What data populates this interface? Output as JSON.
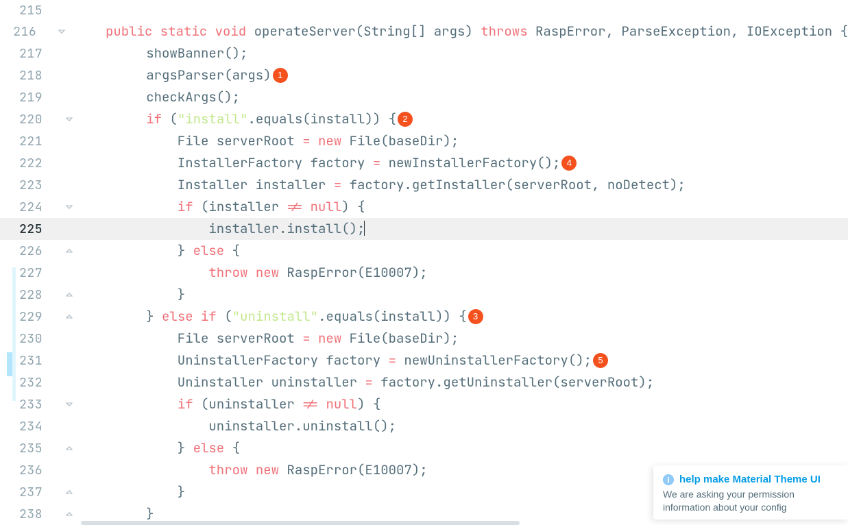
{
  "lines": [
    {
      "num": 215,
      "fold": "",
      "hl": false,
      "badge": null,
      "tokens": []
    },
    {
      "num": 216,
      "fold": "start",
      "hl": false,
      "badge": null,
      "tokens": [
        [
          "pun",
          "    "
        ],
        [
          "kw",
          "public"
        ],
        [
          "pun",
          " "
        ],
        [
          "kw",
          "static"
        ],
        [
          "pun",
          " "
        ],
        [
          "kw",
          "void"
        ],
        [
          "pun",
          " "
        ],
        [
          "id",
          "operateServer(String[] args) "
        ],
        [
          "kw",
          "throws"
        ],
        [
          "pun",
          " RaspError, ParseException, IOException {"
        ]
      ]
    },
    {
      "num": 217,
      "fold": "",
      "hl": false,
      "badge": null,
      "tokens": [
        [
          "pun",
          "        showBanner();"
        ]
      ]
    },
    {
      "num": 218,
      "fold": "",
      "hl": false,
      "badge": "1",
      "tokens": [
        [
          "pun",
          "        argsParser(args)"
        ]
      ]
    },
    {
      "num": 219,
      "fold": "",
      "hl": false,
      "badge": null,
      "tokens": [
        [
          "pun",
          "        checkArgs();"
        ]
      ]
    },
    {
      "num": 220,
      "fold": "start",
      "hl": false,
      "badge": "2",
      "tokens": [
        [
          "pun",
          "        "
        ],
        [
          "kw",
          "if"
        ],
        [
          "pun",
          " ("
        ],
        [
          "str",
          "\"install\""
        ],
        [
          "pun",
          ".equals(install)) {"
        ]
      ]
    },
    {
      "num": 221,
      "fold": "",
      "hl": false,
      "badge": null,
      "tokens": [
        [
          "pun",
          "            File serverRoot "
        ],
        [
          "op",
          "="
        ],
        [
          "pun",
          " "
        ],
        [
          "kw",
          "new"
        ],
        [
          "pun",
          " File(baseDir);"
        ]
      ]
    },
    {
      "num": 222,
      "fold": "",
      "hl": false,
      "badge": "4",
      "tokens": [
        [
          "pun",
          "            InstallerFactory factory "
        ],
        [
          "op",
          "="
        ],
        [
          "pun",
          " newInstallerFactory();"
        ]
      ]
    },
    {
      "num": 223,
      "fold": "",
      "hl": false,
      "badge": null,
      "tokens": [
        [
          "pun",
          "            Installer installer "
        ],
        [
          "op",
          "="
        ],
        [
          "pun",
          " factory.getInstaller(serverRoot, noDetect);"
        ]
      ]
    },
    {
      "num": 224,
      "fold": "start",
      "hl": false,
      "badge": null,
      "tokens": [
        [
          "pun",
          "            "
        ],
        [
          "kw",
          "if"
        ],
        [
          "pun",
          " (installer "
        ],
        [
          "op",
          "!="
        ],
        [
          "pun",
          " "
        ],
        [
          "kw",
          "null"
        ],
        [
          "pun",
          ") {"
        ]
      ]
    },
    {
      "num": 225,
      "fold": "",
      "hl": true,
      "badge": null,
      "cursor": true,
      "tokens": [
        [
          "pun",
          "                installer.install();"
        ]
      ]
    },
    {
      "num": 226,
      "fold": "end",
      "hl": false,
      "badge": null,
      "tokens": [
        [
          "pun",
          "            } "
        ],
        [
          "kw",
          "else"
        ],
        [
          "pun",
          " {"
        ]
      ]
    },
    {
      "num": 227,
      "fold": "",
      "hl": false,
      "mark": true,
      "badge": null,
      "tokens": [
        [
          "pun",
          "                "
        ],
        [
          "kw",
          "throw"
        ],
        [
          "pun",
          " "
        ],
        [
          "kw",
          "new"
        ],
        [
          "pun",
          " RaspError(E10007);"
        ]
      ]
    },
    {
      "num": 228,
      "fold": "end",
      "hl": false,
      "mark": true,
      "badge": null,
      "tokens": [
        [
          "pun",
          "            }"
        ]
      ]
    },
    {
      "num": 229,
      "fold": "end",
      "hl": false,
      "mark": true,
      "badge": "3",
      "tokens": [
        [
          "pun",
          "        } "
        ],
        [
          "kw",
          "else"
        ],
        [
          "pun",
          " "
        ],
        [
          "kw",
          "if"
        ],
        [
          "pun",
          " ("
        ],
        [
          "str",
          "\"uninstall\""
        ],
        [
          "pun",
          ".equals(install)) {"
        ]
      ]
    },
    {
      "num": 230,
      "fold": "",
      "hl": false,
      "mark": true,
      "badge": null,
      "tokens": [
        [
          "pun",
          "            File serverRoot "
        ],
        [
          "op",
          "="
        ],
        [
          "pun",
          " "
        ],
        [
          "kw",
          "new"
        ],
        [
          "pun",
          " File(baseDir);"
        ]
      ]
    },
    {
      "num": 231,
      "fold": "",
      "hl": false,
      "mark": true,
      "markStrong": true,
      "badge": "5",
      "tokens": [
        [
          "pun",
          "            UninstallerFactory factory "
        ],
        [
          "op",
          "="
        ],
        [
          "pun",
          " newUninstallerFactory();"
        ]
      ]
    },
    {
      "num": 232,
      "fold": "",
      "hl": false,
      "mark": true,
      "badge": null,
      "tokens": [
        [
          "pun",
          "            Uninstaller uninstaller "
        ],
        [
          "op",
          "="
        ],
        [
          "pun",
          " factory.getUninstaller(serverRoot);"
        ]
      ]
    },
    {
      "num": 233,
      "fold": "start",
      "hl": false,
      "badge": null,
      "tokens": [
        [
          "pun",
          "            "
        ],
        [
          "kw",
          "if"
        ],
        [
          "pun",
          " (uninstaller "
        ],
        [
          "op",
          "!="
        ],
        [
          "pun",
          " "
        ],
        [
          "kw",
          "null"
        ],
        [
          "pun",
          ") {"
        ]
      ]
    },
    {
      "num": 234,
      "fold": "",
      "hl": false,
      "badge": null,
      "tokens": [
        [
          "pun",
          "                uninstaller.uninstall();"
        ]
      ]
    },
    {
      "num": 235,
      "fold": "end",
      "hl": false,
      "badge": null,
      "tokens": [
        [
          "pun",
          "            } "
        ],
        [
          "kw",
          "else"
        ],
        [
          "pun",
          " {"
        ]
      ]
    },
    {
      "num": 236,
      "fold": "",
      "hl": false,
      "badge": null,
      "tokens": [
        [
          "pun",
          "                "
        ],
        [
          "kw",
          "throw"
        ],
        [
          "pun",
          " "
        ],
        [
          "kw",
          "new"
        ],
        [
          "pun",
          " RaspError(E10007);"
        ]
      ]
    },
    {
      "num": 237,
      "fold": "end",
      "hl": false,
      "badge": null,
      "tokens": [
        [
          "pun",
          "            }"
        ]
      ]
    },
    {
      "num": 238,
      "fold": "end",
      "hl": false,
      "badge": null,
      "tokens": [
        [
          "pun",
          "        }"
        ]
      ]
    }
  ],
  "toast": {
    "title": "help make Material Theme UI",
    "line1": "We are asking your permission",
    "line2": "information about your config"
  }
}
